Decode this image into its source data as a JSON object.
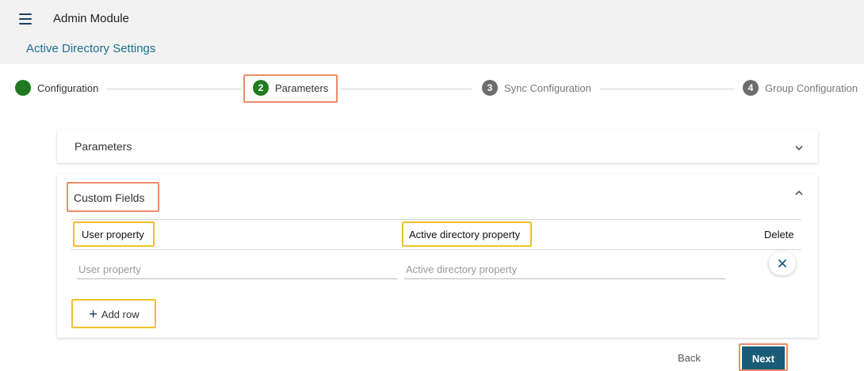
{
  "header": {
    "menu_icon": "hamburger-menu-icon",
    "app_title": "Admin Module",
    "section_title": "Active Directory Settings"
  },
  "stepper": {
    "steps": [
      {
        "number": "",
        "label": "Configuration",
        "state": "completed"
      },
      {
        "number": "2",
        "label": "Parameters",
        "state": "active"
      },
      {
        "number": "3",
        "label": "Sync Configuration",
        "state": "inactive"
      },
      {
        "number": "4",
        "label": "Group Configuration",
        "state": "inactive"
      }
    ]
  },
  "parameters_panel": {
    "title": "Parameters",
    "expanded": false,
    "icon": "chevron-down-icon"
  },
  "custom_fields_panel": {
    "title": "Custom Fields",
    "expanded": true,
    "icon": "chevron-up-icon",
    "columns": {
      "user_property": "User property",
      "ad_property": "Active directory property",
      "delete": "Delete"
    },
    "rows": [
      {
        "user_property_value": "",
        "user_property_placeholder": "User property",
        "ad_property_value": "",
        "ad_property_placeholder": "Active directory property",
        "delete_icon": "close-icon"
      }
    ],
    "add_row_label": "Add row",
    "add_row_icon": "plus-icon"
  },
  "footer": {
    "back_label": "Back",
    "next_label": "Next"
  },
  "colors": {
    "accent": "#1a5c77",
    "step_active": "#1f7a1f",
    "step_inactive": "#6d6d6d",
    "highlight_orange": "#ef8a66",
    "highlight_yellow": "#f2bf2c"
  }
}
